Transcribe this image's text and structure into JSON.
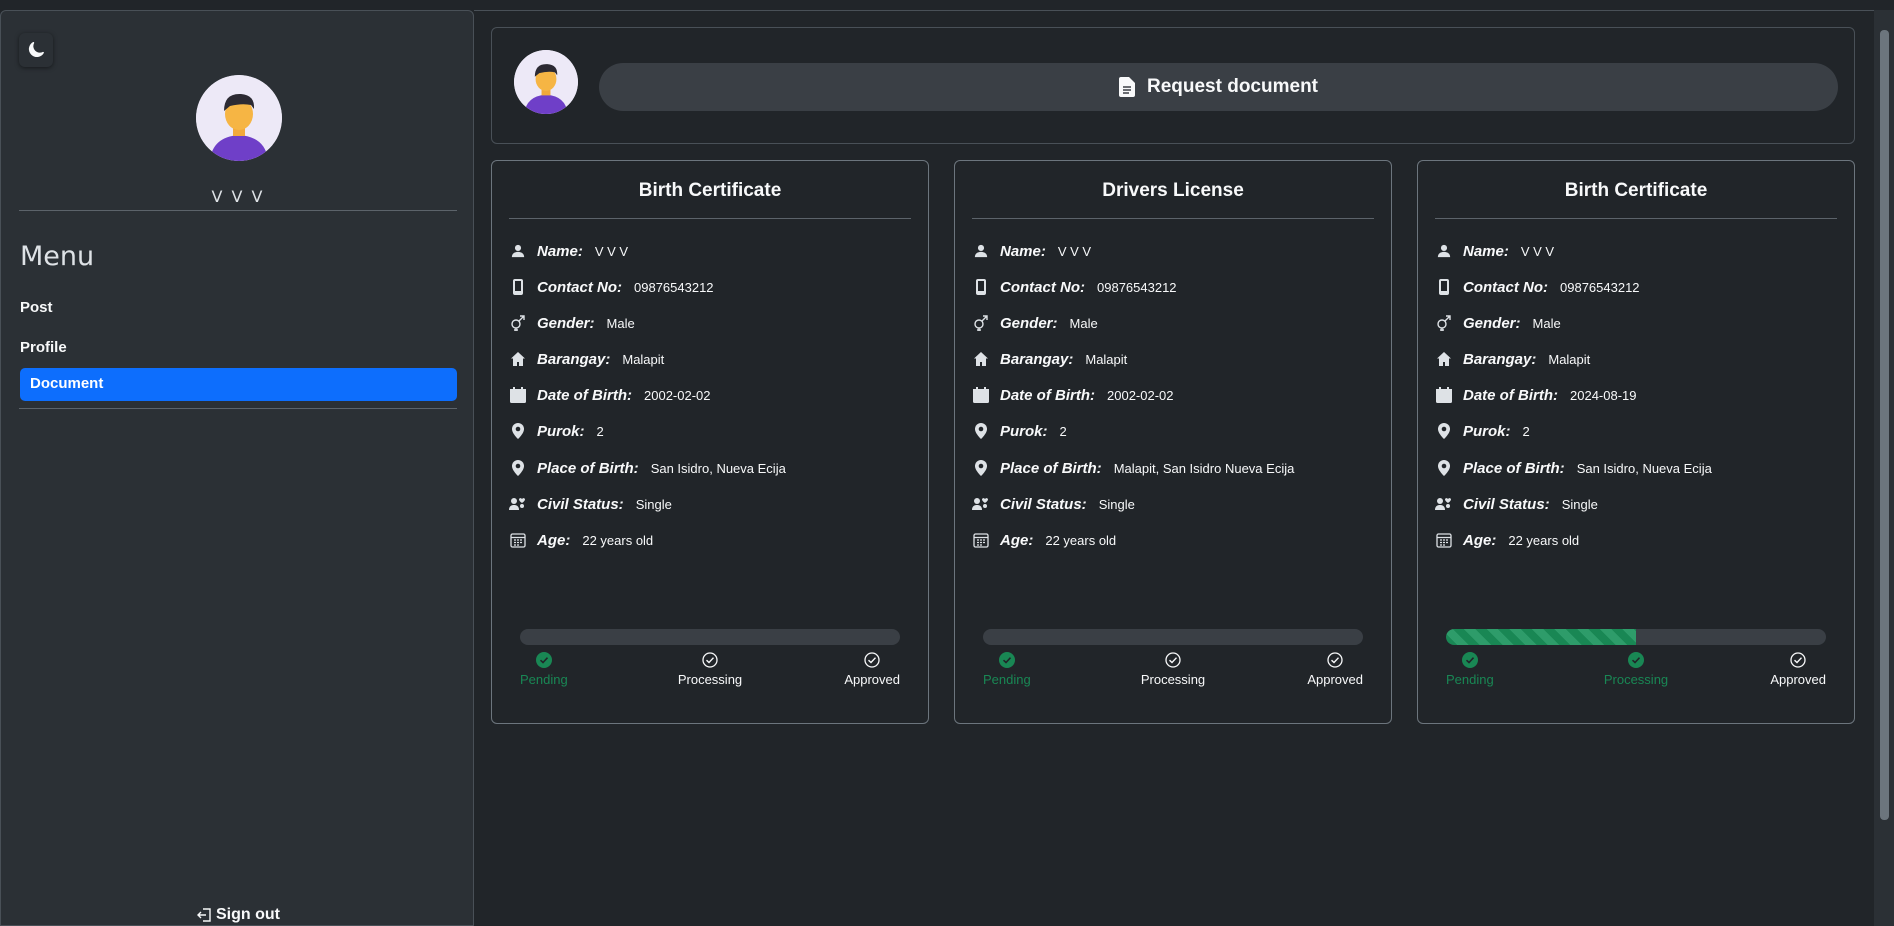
{
  "sidebar": {
    "username": "V V V",
    "menu_title": "Menu",
    "items": [
      {
        "label": "Post"
      },
      {
        "label": "Profile"
      },
      {
        "label": "Document"
      }
    ],
    "signout": "Sign out"
  },
  "header": {
    "request_button": "Request document"
  },
  "labels": {
    "name": "Name:",
    "contact": "Contact No:",
    "gender": "Gender:",
    "barangay": "Barangay:",
    "dob": "Date of Birth:",
    "purok": "Purok:",
    "pob": "Place of Birth:",
    "civil": "Civil Status:",
    "age": "Age:"
  },
  "steps": [
    "Pending",
    "Processing",
    "Approved"
  ],
  "cards": [
    {
      "title": "Birth Certificate",
      "name": "V V V",
      "contact": "09876543212",
      "gender": "Male",
      "barangay": "Malapit",
      "dob": "2002-02-02",
      "purok": "2",
      "pob": "San Isidro, Nueva Ecija",
      "civil": "Single",
      "age": "22 years old",
      "progress": 0,
      "completed_steps": 1
    },
    {
      "title": "Drivers License",
      "name": "V V V",
      "contact": "09876543212",
      "gender": "Male",
      "barangay": "Malapit",
      "dob": "2002-02-02",
      "purok": "2",
      "pob": "Malapit, San Isidro Nueva Ecija",
      "civil": "Single",
      "age": "22 years old",
      "progress": 0,
      "completed_steps": 1
    },
    {
      "title": "Birth Certificate",
      "name": "V V V",
      "contact": "09876543212",
      "gender": "Male",
      "barangay": "Malapit",
      "dob": "2024-08-19",
      "purok": "2",
      "pob": "San Isidro, Nueva Ecija",
      "civil": "Single",
      "age": "22 years old",
      "progress": 0.5,
      "completed_steps": 2
    }
  ],
  "colors": {
    "accent": "#0d6efd",
    "success": "#198754"
  }
}
